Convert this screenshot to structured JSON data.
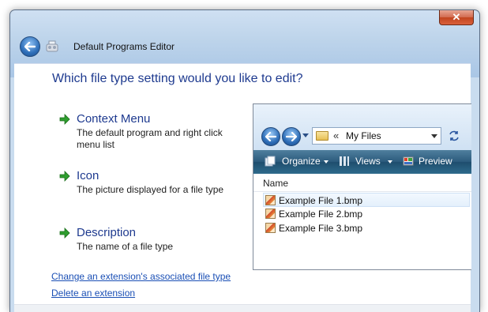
{
  "window": {
    "title": "Default Programs Editor",
    "close_glyph": "✕"
  },
  "main": {
    "heading": "Which file type setting would you like to edit?",
    "options": [
      {
        "title": "Context Menu",
        "description": "The default program and right click menu list"
      },
      {
        "title": "Icon",
        "description": "The picture displayed for a file type"
      },
      {
        "title": "Description",
        "description": "The name of a file type"
      }
    ],
    "links": [
      "Change an extension's associated file type",
      "Delete an extension"
    ]
  },
  "preview": {
    "address_chevron": "«",
    "address": "My Files",
    "toolbar": [
      "Organize",
      "Views",
      "Preview"
    ],
    "column_header": "Name",
    "files": [
      "Example File 1.bmp",
      "Example File 2.bmp",
      "Example File 3.bmp"
    ]
  },
  "icons": {
    "back": "back-arrow-icon",
    "option_arrow": "green-arrow-icon",
    "refresh": "refresh-icon",
    "colors": {
      "heading": "#1e3a8f",
      "link": "#1a4fb5",
      "arrow": "#2f9e2f"
    }
  }
}
